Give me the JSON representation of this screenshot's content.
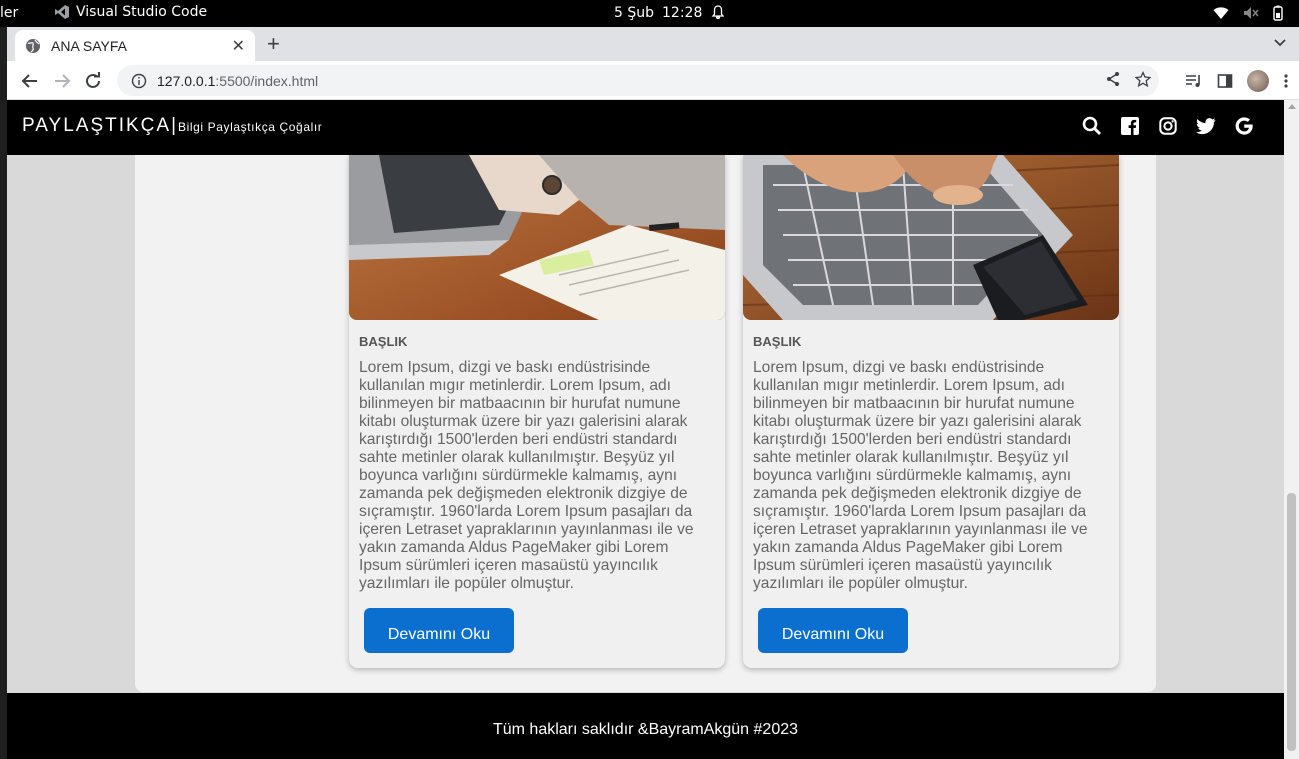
{
  "os": {
    "left_text": "ler",
    "app_name": "Visual Studio Code",
    "date": "5 Şub",
    "time": "12:28"
  },
  "browser": {
    "tab_title": "ANA SAYFA",
    "url_host": "127.0.0.1",
    "url_path": ":5500/index.html"
  },
  "site": {
    "brand": "PAYLAŞTIKÇA|",
    "tagline": "Bilgi Paylaştıkça Çoğalır",
    "social_icons": [
      "search-icon",
      "facebook-icon",
      "instagram-icon",
      "twitter-icon",
      "google-icon"
    ]
  },
  "cards": [
    {
      "title": "BAŞLIK",
      "text": "Lorem Ipsum, dizgi ve baskı endüstrisinde kullanılan mıgır metinlerdir. Lorem Ipsum, adı bilinmeyen bir matbaacının bir hurufat numune kitabı oluşturmak üzere bir yazı galerisini alarak karıştırdığı 1500'lerden beri endüstri standardı sahte metinler olarak kullanılmıştır. Beşyüz yıl boyunca varlığını sürdürmekle kalmamış, aynı zamanda pek değişmeden elektronik dizgiye de sıçramıştır. 1960'larda Lorem Ipsum pasajları da içeren Letraset yapraklarının yayınlanması ile ve yakın zamanda Aldus PageMaker gibi Lorem Ipsum sürümleri içeren masaüstü yayıncılık yazılımları ile popüler olmuştur.",
      "button": "Devamını Oku"
    },
    {
      "title": "BAŞLIK",
      "text": "Lorem Ipsum, dizgi ve baskı endüstrisinde kullanılan mıgır metinlerdir. Lorem Ipsum, adı bilinmeyen bir matbaacının bir hurufat numune kitabı oluşturmak üzere bir yazı galerisini alarak karıştırdığı 1500'lerden beri endüstri standardı sahte metinler olarak kullanılmıştır. Beşyüz yıl boyunca varlığını sürdürmekle kalmamış, aynı zamanda pek değişmeden elektronik dizgiye de sıçramıştır. 1960'larda Lorem Ipsum pasajları da içeren Letraset yapraklarının yayınlanması ile ve yakın zamanda Aldus PageMaker gibi Lorem Ipsum sürümleri içeren masaüstü yayıncılık yazılımları ile popüler olmuştur.",
      "button": "Devamını Oku"
    }
  ],
  "footer": {
    "text": "Tüm hakları saklıdır &BayramAkgün #2023"
  },
  "colors": {
    "button": "#0b6fd0",
    "header": "#000000",
    "page_bg": "#d9d9d9"
  }
}
